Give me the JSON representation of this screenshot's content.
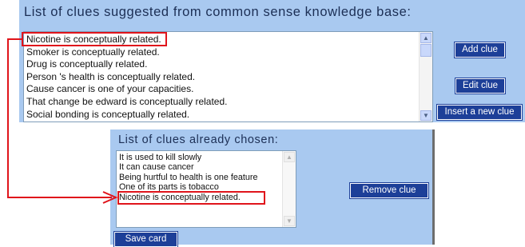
{
  "suggested": {
    "title": "List of clues suggested from common sense knowledge base:",
    "items": [
      "Nicotine is conceptually related.",
      "Smoker is conceptually related.",
      "Drug is conceptually related.",
      "Person 's health is conceptually related.",
      "Cause cancer is one of your capacities.",
      "That change be edward is conceptually related.",
      "Social bonding is conceptually related."
    ],
    "buttons": {
      "add": "Add clue",
      "edit": "Edit clue",
      "insert": "Insert a new clue"
    }
  },
  "chosen": {
    "title": "List of clues already chosen:",
    "items": [
      "It is used to kill slowly",
      "It can cause cancer",
      "Being hurtful to health is one feature",
      "One of its parts is tobacco",
      "Nicotine is conceptually related."
    ],
    "buttons": {
      "remove": "Remove clue",
      "save": "Save card"
    }
  },
  "colors": {
    "panel": "#a9c9f0",
    "button": "#1d3f98",
    "highlight": "#e0141b"
  },
  "icons": {
    "scroll_up": "scroll-up-arrow-icon",
    "scroll_down": "scroll-down-arrow-icon",
    "connector": "red-connector-arrow-icon"
  }
}
